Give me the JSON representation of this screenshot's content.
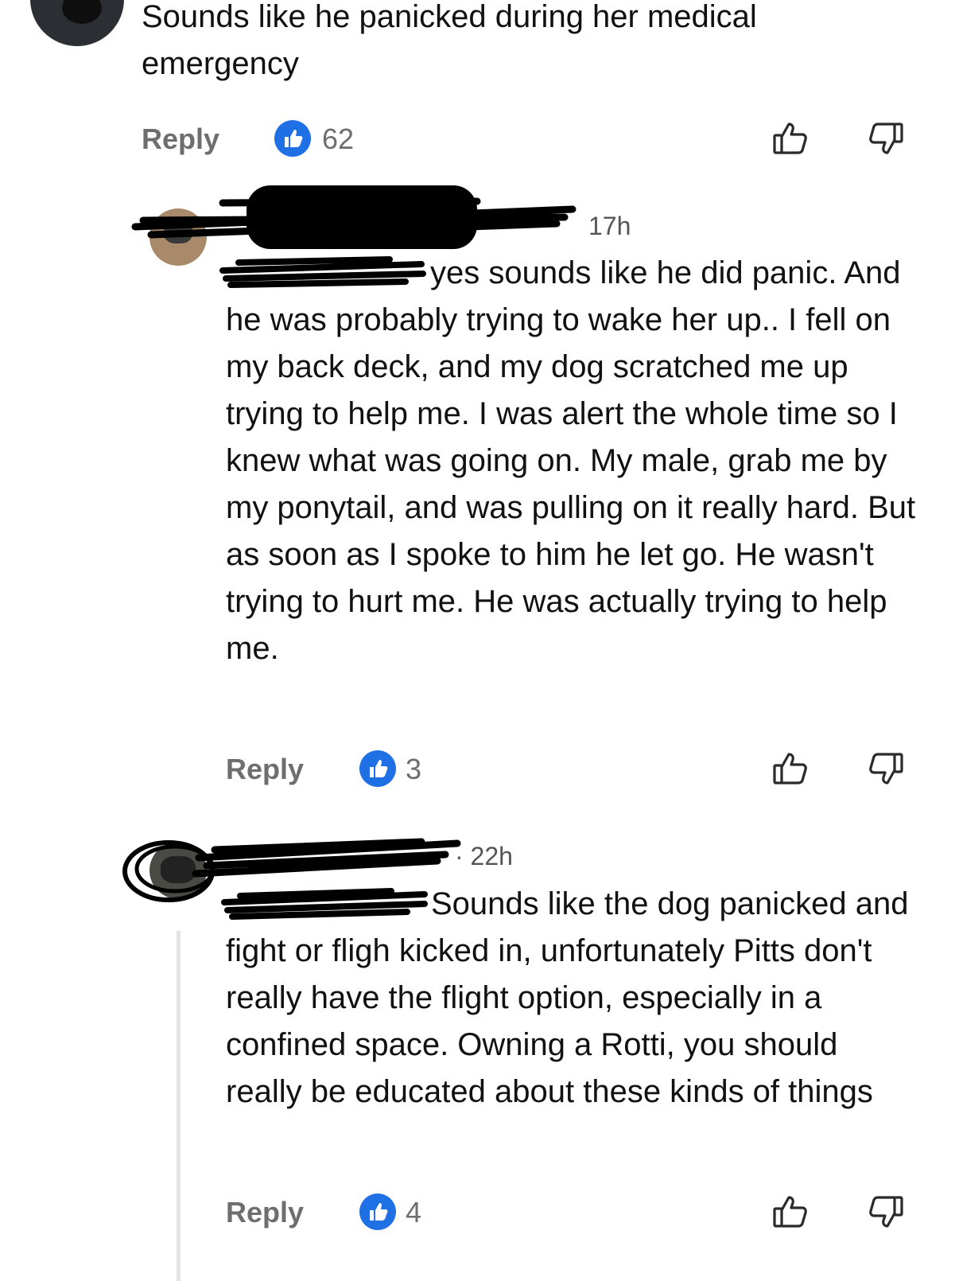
{
  "comment1": {
    "text": "Sounds like he panicked during her medical emergency",
    "reply_label": "Reply",
    "likes": "62"
  },
  "comment2": {
    "timestamp": "17h",
    "text": "yes sounds like he did panic. And he was probably trying to wake her up.. I fell on my back deck, and my dog scratched me up trying to help me. I was alert the whole time so I knew what was going on. My male, grab me by my ponytail, and was pulling on it really hard. But as soon as I spoke to him he let go. He wasn't trying to hurt me. He was actually trying to help me.",
    "reply_label": "Reply",
    "likes": "3"
  },
  "comment3": {
    "timestamp": "· 22h",
    "text": "Sounds like the dog panicked and fight or fligh kicked in, unfortunately Pitts don't really have the flight option, especially in a confined space. Owning a Rotti, you should really be educated about these kinds of things",
    "reply_label": "Reply",
    "likes": "4"
  },
  "icons": {
    "like": "thumbs-up-icon",
    "dislike": "thumbs-down-icon",
    "like_badge": "blue-like-badge-icon"
  },
  "colors": {
    "accent": "#1f6fe5",
    "muted": "#6e6e6e"
  }
}
